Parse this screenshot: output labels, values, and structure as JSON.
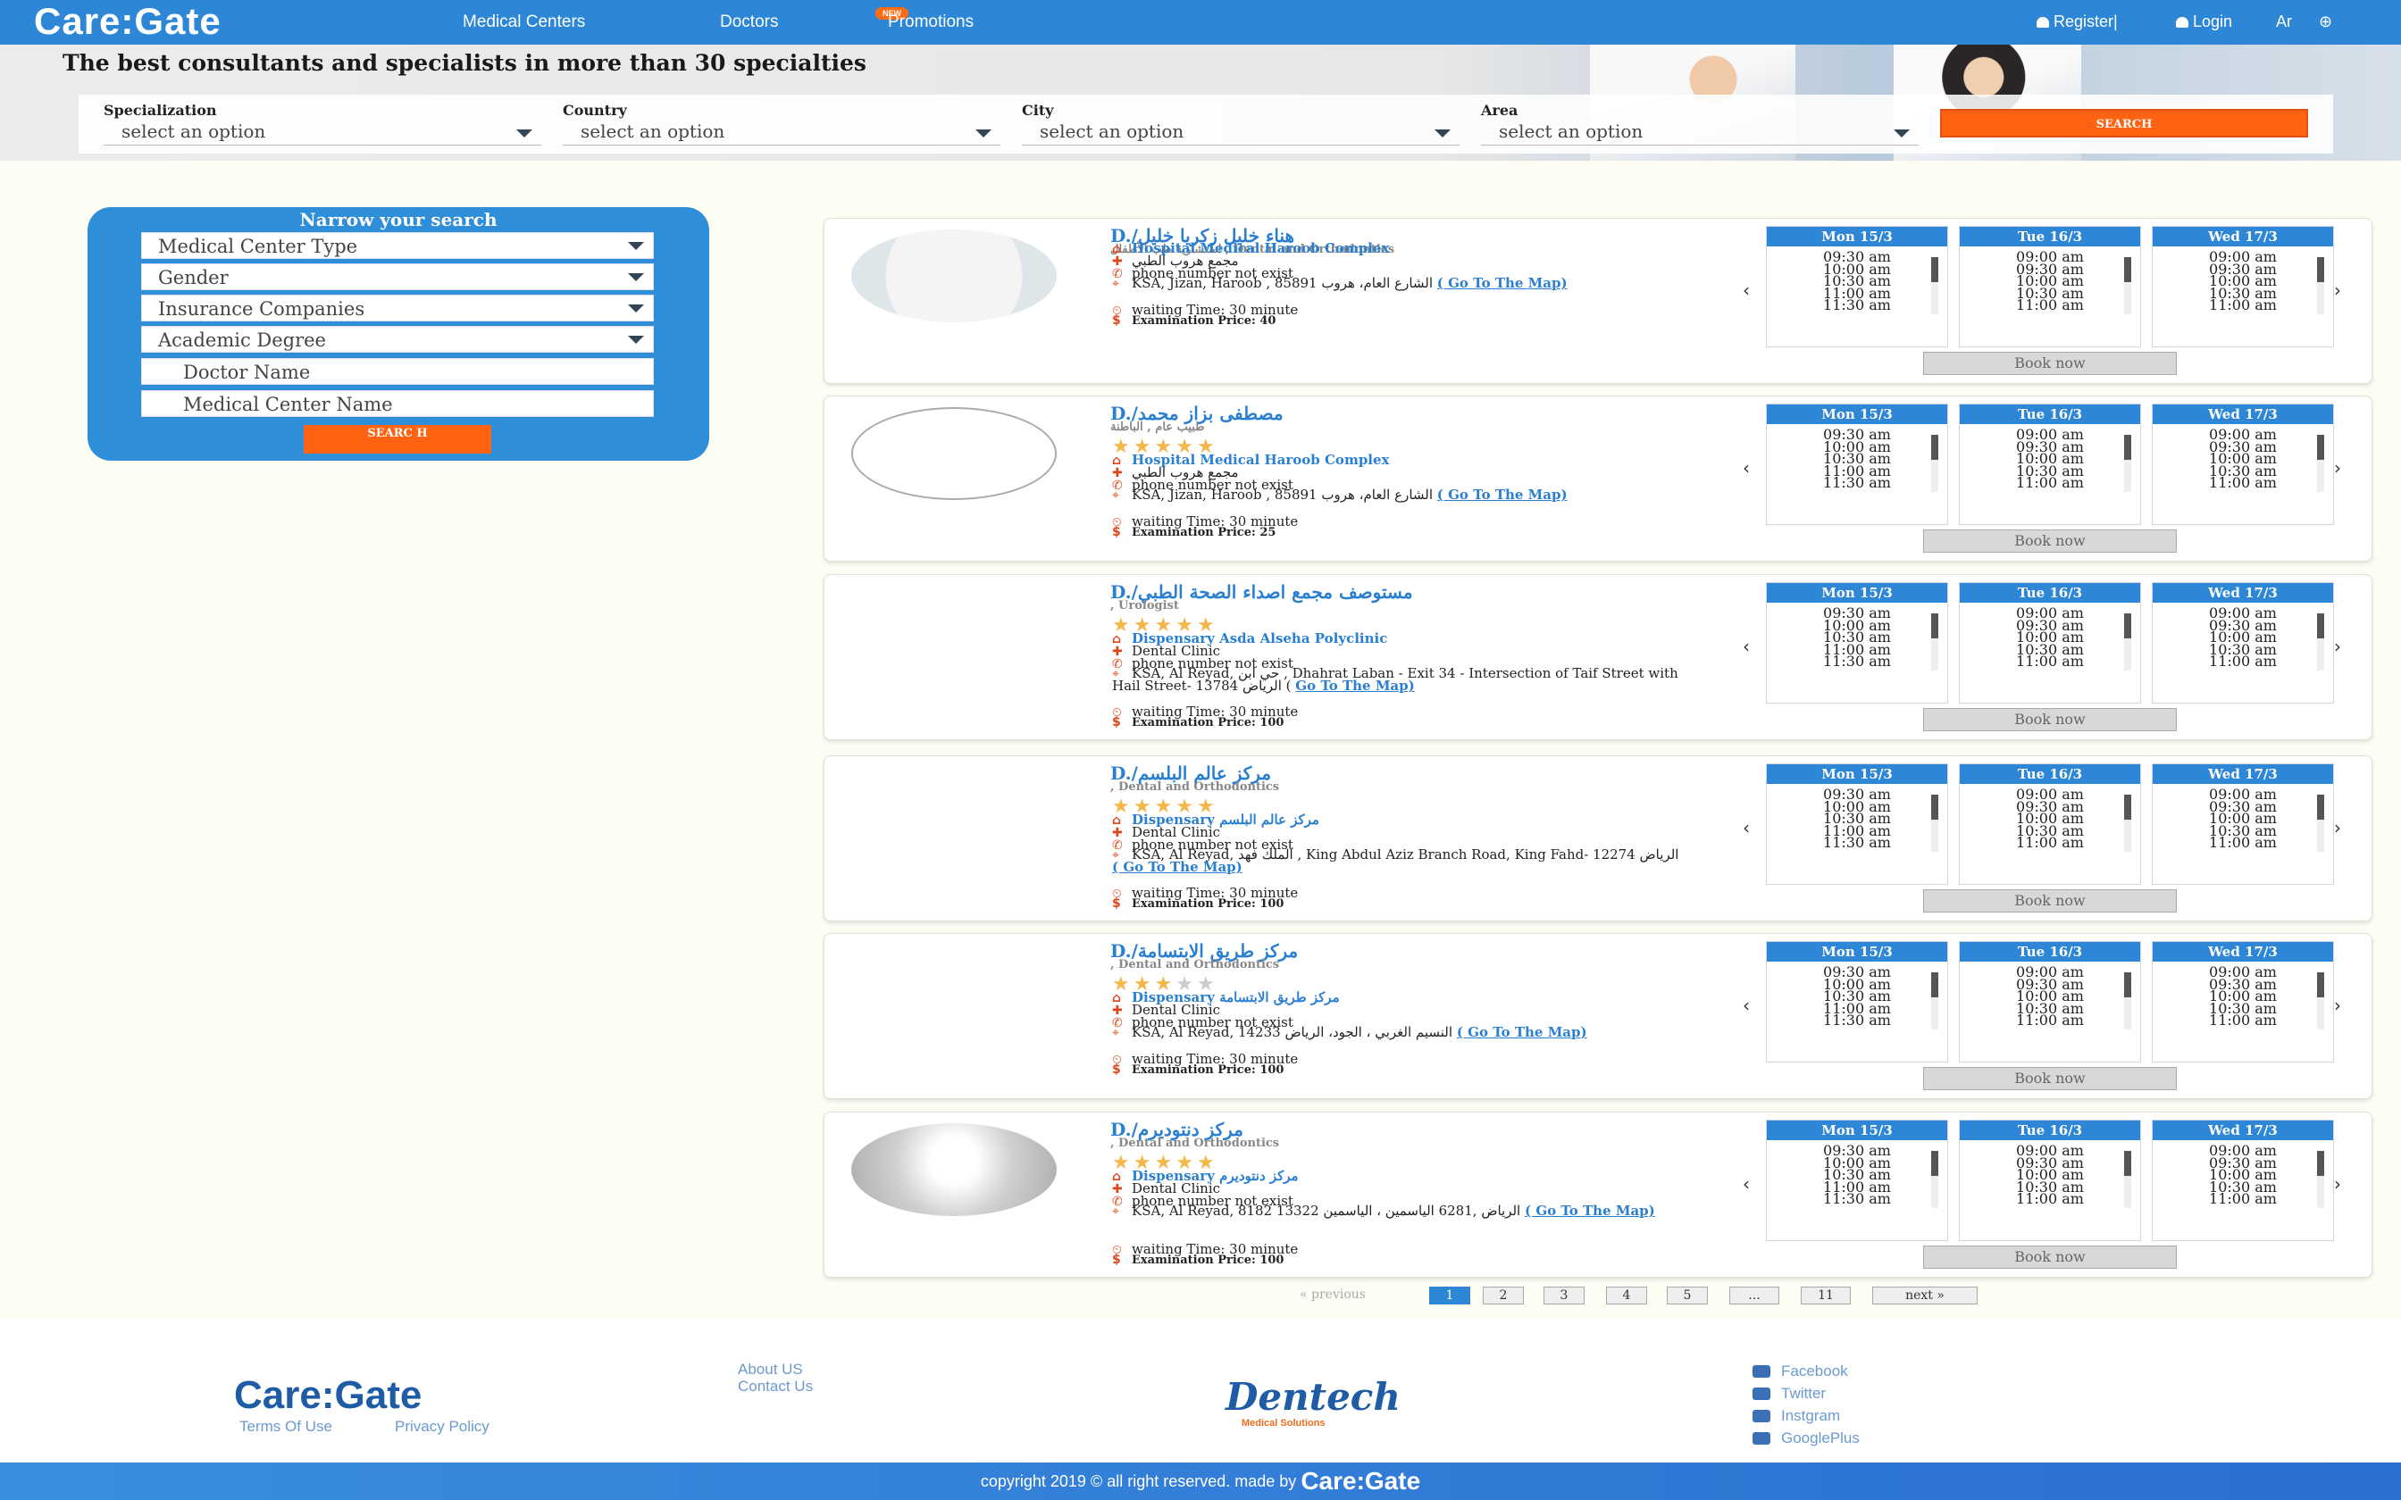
{
  "nav": {
    "logo": "Care:Gate",
    "links": [
      "Medical Centers",
      "Doctors",
      "Promotions"
    ],
    "new_badge": "NEW",
    "register": "Register|",
    "login": "Login",
    "lang": "Ar"
  },
  "hero": {
    "title": "The best consultants and specialists in more than 30 specialties",
    "fields": [
      {
        "label": "Specialization",
        "value": "select an option"
      },
      {
        "label": "Country",
        "value": "select an option"
      },
      {
        "label": "City",
        "value": "select an option"
      },
      {
        "label": "Area",
        "value": "select an option"
      }
    ],
    "search_label": "SEARCH"
  },
  "sidebar": {
    "title": "Narrow your search",
    "selects": [
      "Medical Center Type",
      "Gender",
      "Insurance Companies",
      "Academic Degree"
    ],
    "inputs": [
      "Doctor Name",
      "Medical Center Name"
    ],
    "search_label": "SEARC H"
  },
  "days": [
    "Mon 15/3",
    "Tue 16/3",
    "Wed 17/3"
  ],
  "book_label": "Book now",
  "cards": [
    {
      "name": "D./هناء خليل زكريا خليل",
      "spec": "استشارية طب الأطفال , Dental and Orthodontics",
      "rating": 0,
      "center": "Hospital Medical Haroob Complex",
      "center_ar": "مجمع هروب الطبي",
      "phone": "phone number not exist",
      "address": "KSA, Jizan, Haroob , 85891 الشارع العام، هروب",
      "map": "( Go To The Map)",
      "waiting": "waiting Time: 30 minute",
      "price": "Examination Price: 40",
      "slots": [
        [
          "09:30 am",
          "10:00 am",
          "10:30 am",
          "11:00 am",
          "11:30 am"
        ],
        [
          "09:00 am",
          "09:30 am",
          "10:00 am",
          "10:30 am",
          "11:00 am"
        ],
        [
          "09:00 am",
          "09:30 am",
          "10:00 am",
          "10:30 am",
          "11:00 am"
        ]
      ]
    },
    {
      "name": "D./مصطفى بزاز محمد",
      "spec": "طبيب عام , الباطنة",
      "rating": 5,
      "center": "Hospital Medical Haroob Complex",
      "center_ar": "مجمع هروب الطبي",
      "phone": "phone number not exist",
      "address": "KSA, Jizan, Haroob , 85891 الشارع العام، هروب",
      "map": "( Go To The Map)",
      "waiting": "waiting Time: 30 minute",
      "price": "Examination Price: 25",
      "slots": [
        [
          "09:30 am",
          "10:00 am",
          "10:30 am",
          "11:00 am",
          "11:30 am"
        ],
        [
          "09:00 am",
          "09:30 am",
          "10:00 am",
          "10:30 am",
          "11:00 am"
        ],
        [
          "09:00 am",
          "09:30 am",
          "10:00 am",
          "10:30 am",
          "11:00 am"
        ]
      ]
    },
    {
      "name": "D./مستوصف مجمع اصداء الصحة الطبي",
      "spec": ", Urologist",
      "rating": 5,
      "center": "Dispensary Asda Alseha Polyclinic",
      "center_ar": "Dental Clinic",
      "phone": "phone number not exist",
      "address": "KSA, Al Reyad, حي ابن , Dhahrat Laban - Exit 34 - Intersection of Taif Street with Hail Street- 13784 الرياض (",
      "map": "Go To The Map)",
      "waiting": "waiting Time: 30 minute",
      "price": "Examination Price: 100",
      "slots": [
        [
          "09:30 am",
          "10:00 am",
          "10:30 am",
          "11:00 am",
          "11:30 am"
        ],
        [
          "09:00 am",
          "09:30 am",
          "10:00 am",
          "10:30 am",
          "11:00 am"
        ],
        [
          "09:00 am",
          "09:30 am",
          "10:00 am",
          "10:30 am",
          "11:00 am"
        ]
      ]
    },
    {
      "name": "D./مركز عالم البلسم",
      "spec": ", Dental and Orthodontics",
      "rating": 5,
      "center": "Dispensary مركز عالم البلسم",
      "center_ar": "Dental Clinic",
      "phone": "phone number not exist",
      "address": "KSA, Al Reyad, الملك فهد , King Abdul Aziz Branch Road, King Fahd- 12274 الرياض",
      "map": "( Go To The Map)",
      "waiting": "waiting Time: 30 minute",
      "price": "Examination Price: 100",
      "slots": [
        [
          "09:30 am",
          "10:00 am",
          "10:30 am",
          "11:00 am",
          "11:30 am"
        ],
        [
          "09:00 am",
          "09:30 am",
          "10:00 am",
          "10:30 am",
          "11:00 am"
        ],
        [
          "09:00 am",
          "09:30 am",
          "10:00 am",
          "10:30 am",
          "11:00 am"
        ]
      ]
    },
    {
      "name": "D./مركز طريق الابتسامة",
      "spec": ", Dental and Orthodontics",
      "rating": 3,
      "center": "Dispensary مركز طريق الابتسامة",
      "center_ar": "Dental Clinic",
      "phone": "phone number not exist",
      "address": "KSA, Al Reyad, 14233 النسيم الغربي ، الجود، الرياض",
      "map": "( Go To The Map)",
      "waiting": "waiting Time: 30 minute",
      "price": "Examination Price: 100",
      "slots": [
        [
          "09:30 am",
          "10:00 am",
          "10:30 am",
          "11:00 am",
          "11:30 am"
        ],
        [
          "09:00 am",
          "09:30 am",
          "10:00 am",
          "10:30 am",
          "11:00 am"
        ],
        [
          "09:00 am",
          "09:30 am",
          "10:00 am",
          "10:30 am",
          "11:00 am"
        ]
      ]
    },
    {
      "name": "D./مركز دنتوديرم",
      "spec": ", Dental and Orthodontics",
      "rating": 5,
      "center": "Dispensary مركز دنتوديرم",
      "center_ar": "Dental Clinic",
      "phone": "phone number not exist",
      "address": "KSA, Al Reyad, 8182 13322 الرياض ,6281 الياسمين ، الياسمين",
      "map": "( Go To The Map)",
      "waiting": "waiting Time: 30 minute",
      "price": "Examination Price: 100",
      "slots": [
        [
          "09:30 am",
          "10:00 am",
          "10:30 am",
          "11:00 am",
          "11:30 am"
        ],
        [
          "09:00 am",
          "09:30 am",
          "10:00 am",
          "10:30 am",
          "11:00 am"
        ],
        [
          "09:00 am",
          "09:30 am",
          "10:00 am",
          "10:30 am",
          "11:00 am"
        ]
      ]
    }
  ],
  "pager": {
    "previous": "« previous",
    "pages": [
      "1",
      "2",
      "3",
      "4",
      "5",
      "...",
      "11"
    ],
    "next": "next »",
    "active_page": "1"
  },
  "footer": {
    "logo": "Care:Gate",
    "terms": "Terms Of Use",
    "privacy": "Privacy Policy",
    "about": "About US",
    "contact": "Contact Us",
    "partner": "Dentech",
    "partner_sub": "Medical Solutions",
    "social": [
      "Facebook",
      "Twitter",
      "Instgram",
      "GooglePlus"
    ],
    "copyright": "copyright 2019 © all right reserved. made by",
    "copyright_logo": "Care:Gate"
  },
  "colors": {
    "primary": "#2d87d6",
    "accent": "#ff6312",
    "star": "#f3b74a"
  }
}
